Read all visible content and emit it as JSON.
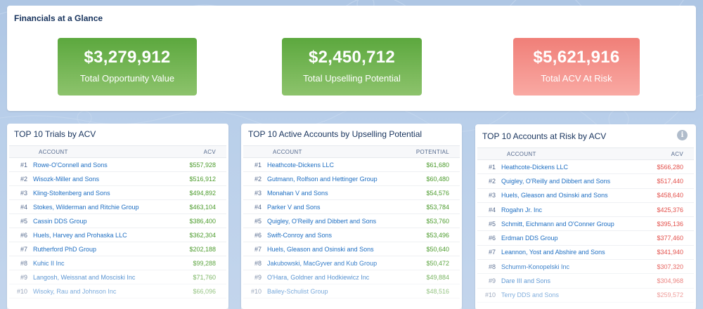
{
  "glance": {
    "title": "Financials at a Glance",
    "tiles": [
      {
        "value": "$3,279,912",
        "label": "Total Opportunity Value",
        "color": "#6ab04c"
      },
      {
        "value": "$2,450,712",
        "label": "Total Upselling Potential",
        "color": "#6ab04c"
      },
      {
        "value": "$5,621,916",
        "label": "Total ACV At Risk",
        "color": "#f4857e"
      }
    ]
  },
  "tables": [
    {
      "title": "TOP 10 Trials by ACV",
      "col_account": "ACCOUNT",
      "col_value": "ACV",
      "value_color": "#4d9c2e",
      "rows": [
        {
          "rank": "#1",
          "account": "Rowe-O'Connell and Sons",
          "value": "$557,928"
        },
        {
          "rank": "#2",
          "account": "Wisozk-Miller and Sons",
          "value": "$516,912"
        },
        {
          "rank": "#3",
          "account": "Kling-Stoltenberg and Sons",
          "value": "$494,892"
        },
        {
          "rank": "#4",
          "account": "Stokes, Wilderman and Ritchie Group",
          "value": "$463,104"
        },
        {
          "rank": "#5",
          "account": "Cassin DDS Group",
          "value": "$386,400"
        },
        {
          "rank": "#6",
          "account": "Huels, Harvey and Prohaska LLC",
          "value": "$362,304"
        },
        {
          "rank": "#7",
          "account": "Rutherford PhD Group",
          "value": "$202,188"
        },
        {
          "rank": "#8",
          "account": "Kuhic II Inc",
          "value": "$99,288"
        },
        {
          "rank": "#9",
          "account": "Langosh, Weissnat and Mosciski Inc",
          "value": "$71,760"
        },
        {
          "rank": "#10",
          "account": "Wisoky, Rau and Johnson Inc",
          "value": "$66,096"
        }
      ]
    },
    {
      "title": "TOP 10 Active Accounts by Upselling Potential",
      "col_account": "ACCOUNT",
      "col_value": "POTENTIAL",
      "value_color": "#4d9c2e",
      "rows": [
        {
          "rank": "#1",
          "account": "Heathcote-Dickens LLC",
          "value": "$61,680"
        },
        {
          "rank": "#2",
          "account": "Gutmann, Rolfson and Hettinger Group",
          "value": "$60,480"
        },
        {
          "rank": "#3",
          "account": "Monahan V and Sons",
          "value": "$54,576"
        },
        {
          "rank": "#4",
          "account": "Parker V and Sons",
          "value": "$53,784"
        },
        {
          "rank": "#5",
          "account": "Quigley, O'Reilly and Dibbert and Sons",
          "value": "$53,760"
        },
        {
          "rank": "#6",
          "account": "Swift-Conroy and Sons",
          "value": "$53,496"
        },
        {
          "rank": "#7",
          "account": "Huels, Gleason and Osinski and Sons",
          "value": "$50,640"
        },
        {
          "rank": "#8",
          "account": "Jakubowski, MacGyver and Kub Group",
          "value": "$50,472"
        },
        {
          "rank": "#9",
          "account": "O'Hara, Goldner and Hodkiewicz Inc",
          "value": "$49,884"
        },
        {
          "rank": "#10",
          "account": "Bailey-Schulist Group",
          "value": "$48,516"
        }
      ]
    },
    {
      "title": "TOP 10 Accounts at Risk by ACV",
      "col_account": "ACCOUNT",
      "col_value": "ACV",
      "value_color": "#e3514c",
      "rows": [
        {
          "rank": "#1",
          "account": "Heathcote-Dickens LLC",
          "value": "$566,280"
        },
        {
          "rank": "#2",
          "account": "Quigley, O'Reilly and Dibbert and Sons",
          "value": "$517,440"
        },
        {
          "rank": "#3",
          "account": "Huels, Gleason and Osinski and Sons",
          "value": "$458,640"
        },
        {
          "rank": "#4",
          "account": "Rogahn Jr. Inc",
          "value": "$425,376"
        },
        {
          "rank": "#5",
          "account": "Schmitt, Eichmann and O'Conner Group",
          "value": "$395,136"
        },
        {
          "rank": "#6",
          "account": "Erdman DDS Group",
          "value": "$377,460"
        },
        {
          "rank": "#7",
          "account": "Leannon, Yost and Abshire and Sons",
          "value": "$341,940"
        },
        {
          "rank": "#8",
          "account": "Schumm-Konopelski Inc",
          "value": "$307,320"
        },
        {
          "rank": "#9",
          "account": "Dare III and Sons",
          "value": "$304,968"
        },
        {
          "rank": "#10",
          "account": "Terry DDS and Sons",
          "value": "$259,572"
        }
      ],
      "info_icon": "info-icon"
    }
  ]
}
